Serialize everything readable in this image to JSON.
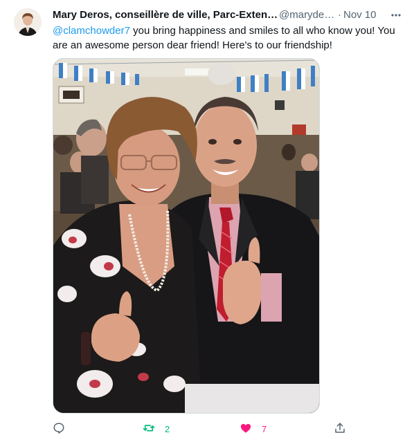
{
  "tweet": {
    "author_name": "Mary Deros, conseillère de ville, Parc-Exten…",
    "handle": "@maryde…",
    "separator": "·",
    "date": "Nov 10",
    "mention": "@clamchowder7",
    "body": " you bring happiness and smiles to all who know you! You are an awesome person dear friend!  Here's to our friendship!",
    "avatar_icon": "profile-photo",
    "more_icon": "more-dots-icon"
  },
  "actions": {
    "reply_count": "",
    "retweet_count": "2",
    "like_count": "7",
    "retweeted": true,
    "liked": true
  },
  "colors": {
    "link": "#1d9bf0",
    "retweet_active": "#00ba7c",
    "like_active": "#f91880",
    "muted": "#536471"
  }
}
